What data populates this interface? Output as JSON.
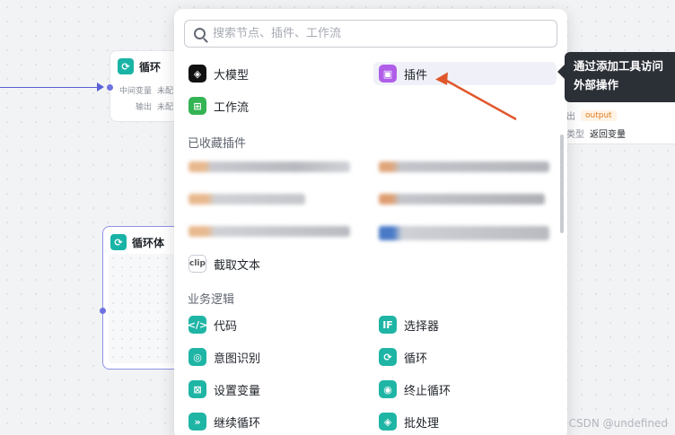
{
  "canvas": {
    "loop_node": {
      "title": "循环",
      "rows": [
        {
          "label": "中间变量",
          "value": "未配"
        },
        {
          "label": "输出",
          "value": "未配"
        }
      ]
    },
    "loop_body_node": {
      "title": "循环体"
    },
    "right_node": {
      "rows": [
        {
          "label": "出",
          "chip": "output"
        },
        {
          "label": "类型",
          "value": "返回变量"
        }
      ]
    }
  },
  "panel": {
    "search": {
      "placeholder": "搜索节点、插件、工作流"
    },
    "top_items": [
      {
        "label": "大模型",
        "icon": "ai-model-icon"
      },
      {
        "label": "插件",
        "icon": "plugin-cube-icon"
      },
      {
        "label": "工作流",
        "icon": "workflow-icon"
      }
    ],
    "favorites_title": "已收藏插件",
    "clip_item": {
      "label": "截取文本",
      "icon": "clip-text-icon",
      "icon_text": "clip"
    },
    "logic_title": "业务逻辑",
    "logic_items": [
      {
        "label": "代码",
        "icon": "code-icon",
        "glyph": "</>"
      },
      {
        "label": "选择器",
        "icon": "if-icon",
        "glyph": "IF"
      },
      {
        "label": "意图识别",
        "icon": "intent-icon",
        "glyph": "◎"
      },
      {
        "label": "循环",
        "icon": "loop-icon",
        "glyph": "⟳"
      },
      {
        "label": "设置变量",
        "icon": "set-variable-icon",
        "glyph": "⊠"
      },
      {
        "label": "终止循环",
        "icon": "stop-loop-icon",
        "glyph": "◉"
      },
      {
        "label": "继续循环",
        "icon": "continue-loop-icon",
        "glyph": "»"
      },
      {
        "label": "批处理",
        "icon": "batch-icon",
        "glyph": "◈"
      }
    ]
  },
  "tooltip": {
    "line1": "通过添加工具访问",
    "line2": "外部操作"
  },
  "watermark": "CSDN @undefined",
  "colors": {
    "accent": "#5b5fd6",
    "teal": "#1fb5a5",
    "plugin": "#b05ee9",
    "annotation": "#e0572c"
  }
}
